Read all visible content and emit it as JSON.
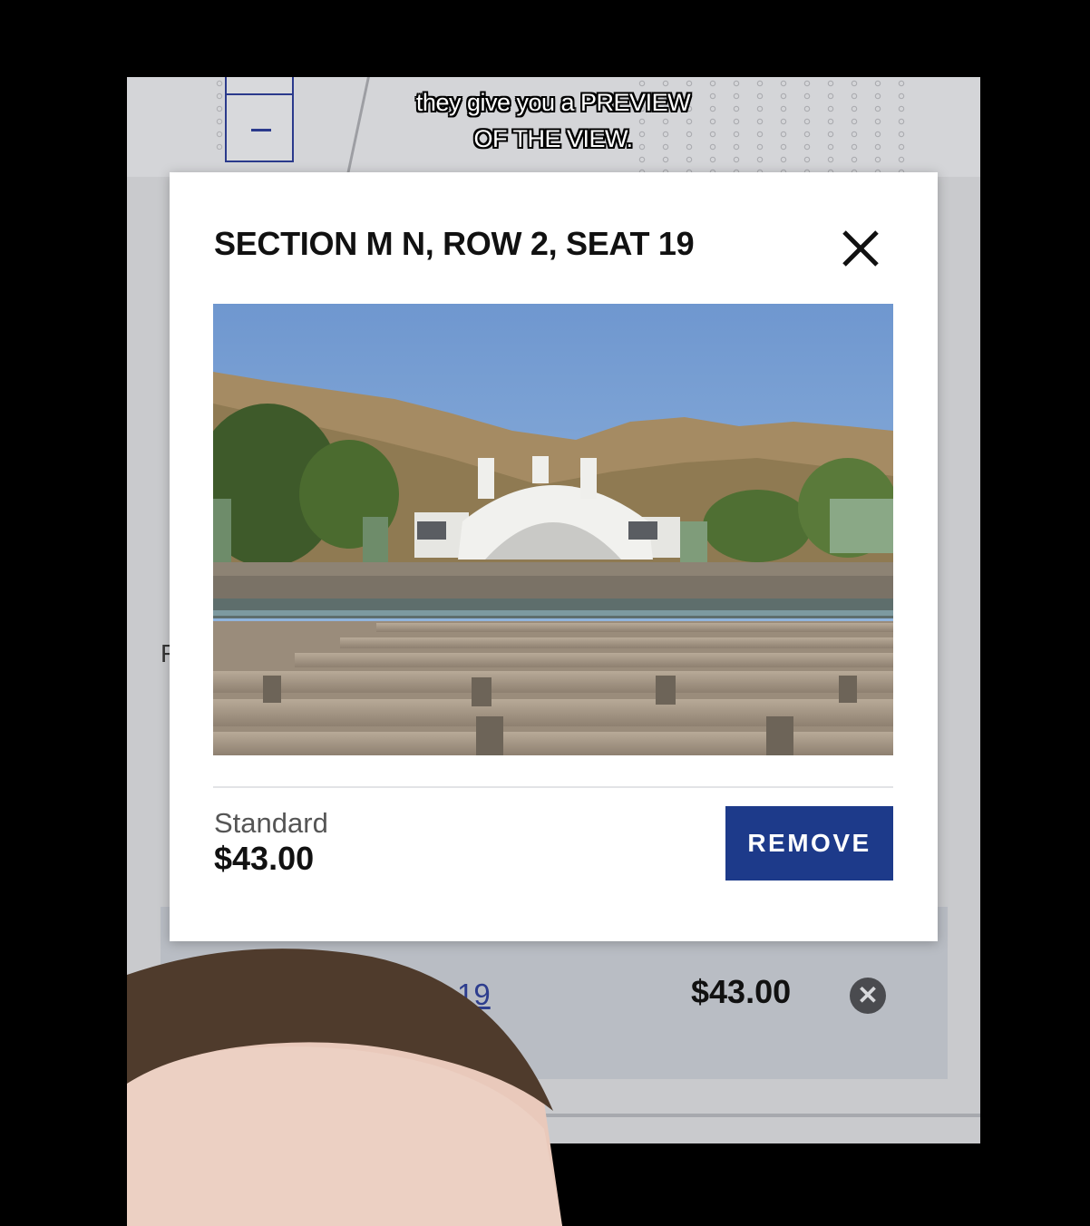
{
  "caption": {
    "line1": "they give you a PREVIEW",
    "line2": "OF THE VIEW."
  },
  "background": {
    "side_letter": "F",
    "cart_item_link": "M N 2-19",
    "cart_item_price": "$43.00"
  },
  "modal": {
    "title": "SECTION M N, ROW 2, SEAT 19",
    "price_type": "Standard",
    "price": "$43.00",
    "remove_label": "REMOVE",
    "accent": "#1d3a8a"
  }
}
